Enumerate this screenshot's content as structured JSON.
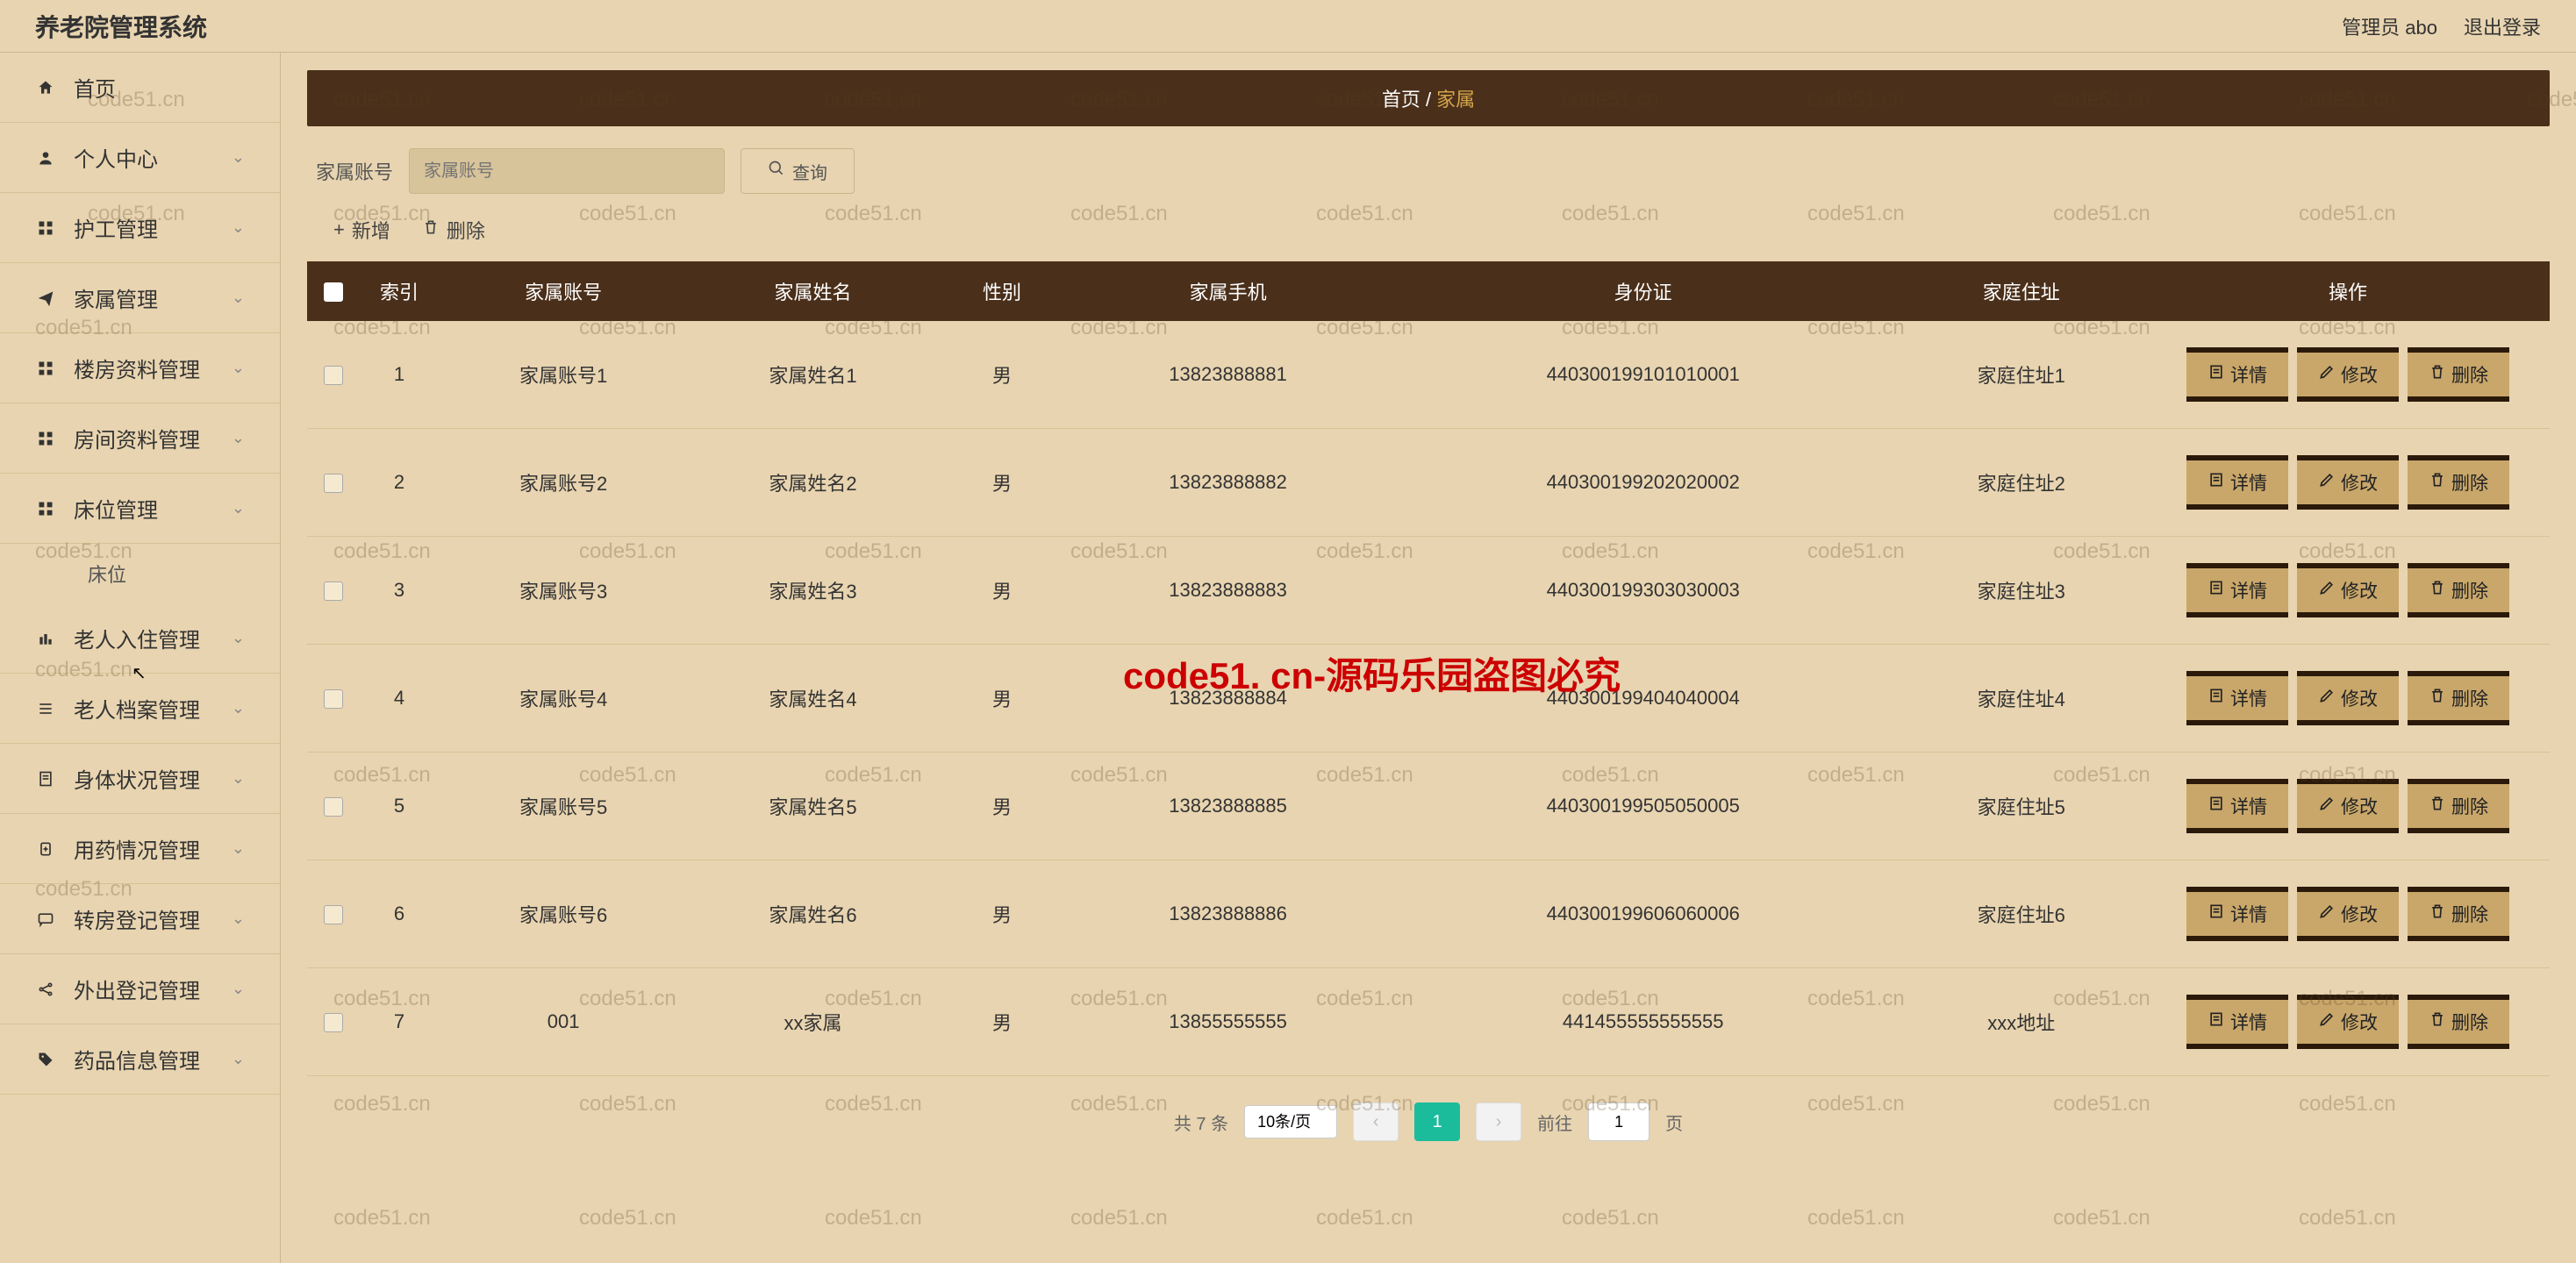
{
  "header": {
    "title": "养老院管理系统",
    "admin_label": "管理员 abo",
    "logout": "退出登录"
  },
  "sidebar": {
    "items": [
      {
        "icon": "home",
        "label": "首页",
        "chevron": false
      },
      {
        "icon": "person",
        "label": "个人中心",
        "chevron": true
      },
      {
        "icon": "grid",
        "label": "护工管理",
        "chevron": true
      },
      {
        "icon": "send",
        "label": "家属管理",
        "chevron": true
      },
      {
        "icon": "grid",
        "label": "楼房资料管理",
        "chevron": true
      },
      {
        "icon": "grid",
        "label": "房间资料管理",
        "chevron": true
      },
      {
        "icon": "grid",
        "label": "床位管理",
        "chevron": true,
        "sub": "床位"
      },
      {
        "icon": "bar",
        "label": "老人入住管理",
        "chevron": true
      },
      {
        "icon": "list",
        "label": "老人档案管理",
        "chevron": true
      },
      {
        "icon": "doc",
        "label": "身体状况管理",
        "chevron": true
      },
      {
        "icon": "med",
        "label": "用药情况管理",
        "chevron": true
      },
      {
        "icon": "msg",
        "label": "转房登记管理",
        "chevron": true
      },
      {
        "icon": "share",
        "label": "外出登记管理",
        "chevron": true
      },
      {
        "icon": "tag",
        "label": "药品信息管理",
        "chevron": true
      }
    ]
  },
  "breadcrumb": {
    "home": "首页",
    "sep": " / ",
    "current": "家属"
  },
  "toolbar": {
    "search_label": "家属账号",
    "search_placeholder": "家属账号",
    "query_btn": "查询",
    "add": "新增",
    "delete": "删除"
  },
  "table": {
    "headers": [
      "",
      "索引",
      "家属账号",
      "家属姓名",
      "性别",
      "家属手机",
      "身份证",
      "家庭住址",
      "操作"
    ],
    "op_labels": {
      "detail": "详情",
      "edit": "修改",
      "delete": "删除"
    },
    "rows": [
      {
        "idx": "1",
        "acct": "家属账号1",
        "name": "家属姓名1",
        "sex": "男",
        "phone": "13823888881",
        "id": "440300199101010001",
        "addr": "家庭住址1"
      },
      {
        "idx": "2",
        "acct": "家属账号2",
        "name": "家属姓名2",
        "sex": "男",
        "phone": "13823888882",
        "id": "440300199202020002",
        "addr": "家庭住址2"
      },
      {
        "idx": "3",
        "acct": "家属账号3",
        "name": "家属姓名3",
        "sex": "男",
        "phone": "13823888883",
        "id": "440300199303030003",
        "addr": "家庭住址3"
      },
      {
        "idx": "4",
        "acct": "家属账号4",
        "name": "家属姓名4",
        "sex": "男",
        "phone": "13823888884",
        "id": "440300199404040004",
        "addr": "家庭住址4"
      },
      {
        "idx": "5",
        "acct": "家属账号5",
        "name": "家属姓名5",
        "sex": "男",
        "phone": "13823888885",
        "id": "440300199505050005",
        "addr": "家庭住址5"
      },
      {
        "idx": "6",
        "acct": "家属账号6",
        "name": "家属姓名6",
        "sex": "男",
        "phone": "13823888886",
        "id": "440300199606060006",
        "addr": "家庭住址6"
      },
      {
        "idx": "7",
        "acct": "001",
        "name": "xx家属",
        "sex": "男",
        "phone": "13855555555",
        "id": "441455555555555",
        "addr": "xxx地址"
      }
    ]
  },
  "pagination": {
    "total": "共 7 条",
    "page_size": "10条/页",
    "current": "1",
    "goto_label": "前往",
    "goto_value": "1",
    "goto_suffix": "页"
  },
  "watermark": {
    "text": "code51.cn",
    "big": "code51. cn-源码乐园盗图必究"
  }
}
